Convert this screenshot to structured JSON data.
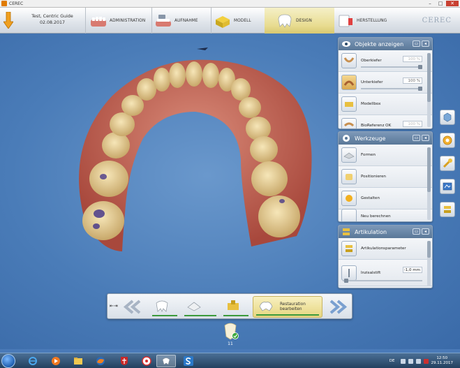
{
  "window": {
    "title": "CEREC",
    "minimize": "–",
    "maximize": "□",
    "close": "✕"
  },
  "patient": {
    "name": "Test, Centric Guide",
    "date": "02.08.2017"
  },
  "workflow": {
    "steps": [
      {
        "label": "ADMINISTRATION",
        "icon": "administration-icon"
      },
      {
        "label": "AUFNAHME",
        "icon": "scan-icon"
      },
      {
        "label": "MODELL",
        "icon": "model-icon"
      },
      {
        "label": "DESIGN",
        "icon": "design-icon",
        "active": true
      },
      {
        "label": "HERSTELLUNG",
        "icon": "manufacturing-icon"
      }
    ],
    "logo": "CEREC"
  },
  "panels": {
    "objects": {
      "title": "Objekte anzeigen",
      "rows": [
        {
          "label": "Oberkiefer",
          "value": "100 %",
          "dim": true,
          "slider": 1.0
        },
        {
          "label": "Unterkiefer",
          "value": "100 %",
          "dim": false,
          "slider": 1.0
        },
        {
          "label": "Modellbox"
        },
        {
          "label": "BioReferenz OK",
          "value": "100 %",
          "dim": true
        }
      ]
    },
    "tools": {
      "title": "Werkzeuge",
      "rows": [
        {
          "label": "Formen"
        },
        {
          "label": "Positionieren"
        },
        {
          "label": "Gestalten"
        },
        {
          "label": "Neu berechnen"
        }
      ]
    },
    "articulation": {
      "title": "Artikulation",
      "rows": [
        {
          "label": "Artikulationsparameter"
        },
        {
          "label": "Inzisalstift",
          "value": "-1,0 mm",
          "slider": 0.05
        }
      ]
    }
  },
  "bottom_bar": {
    "expand": "⇤⇥",
    "active_step_label": "Restauration bearbeiten"
  },
  "restoration": {
    "number": "11"
  },
  "taskbar": {
    "language": "DE",
    "time": "12:50",
    "date": "29.11.2017"
  },
  "colors": {
    "viewport": "#4a7cb8",
    "panel_header": "#6a86a6",
    "design_active": "#e8dc90",
    "progress_green": "#3c9a3c"
  }
}
